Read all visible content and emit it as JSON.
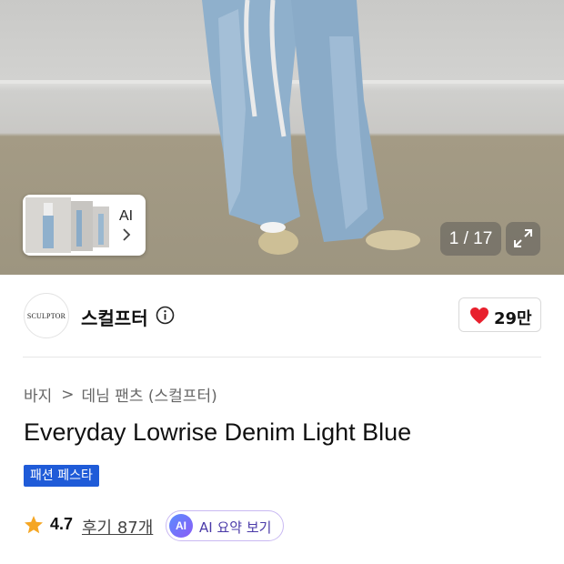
{
  "gallery": {
    "counter": "1 / 17",
    "thumb_badge": "AI",
    "icons": {
      "expand": "expand-icon",
      "next": "chevron-right-icon"
    }
  },
  "brand": {
    "logo_text": "SCULPTOR",
    "name": "스컬프터",
    "info_icon": "info-icon"
  },
  "like": {
    "count": "29만",
    "icon": "heart-icon",
    "color": "#e8202d"
  },
  "breadcrumb": {
    "category": "바지",
    "separator": ">",
    "subcategory": "데님 팬츠 (스컬프터)"
  },
  "product": {
    "title": "Everyday Lowrise Denim Light Blue",
    "promo_badge": "패션 페스타",
    "rating": "4.7",
    "reviews": "후기 87개",
    "ai_summary": {
      "badge": "AI",
      "label": "AI 요약 보기"
    }
  },
  "colors": {
    "accent_blue": "#1f5bd8",
    "star": "#f5a623",
    "ai_border": "#c9b9f2"
  }
}
